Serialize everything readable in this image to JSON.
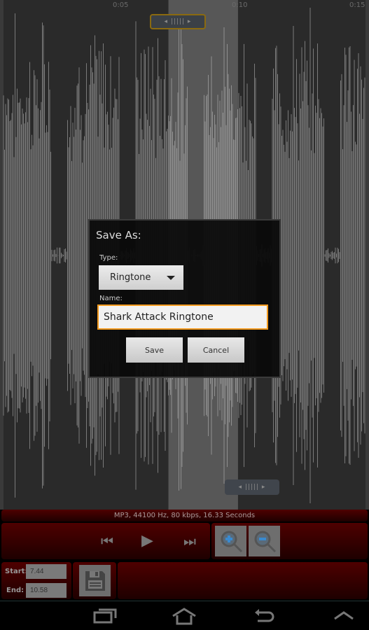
{
  "waveform": {
    "time_ticks": [
      "0:05",
      "0:10",
      "0:15"
    ],
    "selection_start_seconds": 7.44,
    "selection_end_seconds": 10.58,
    "duration_seconds": 16.33
  },
  "info": "MP3, 44100 Hz, 80 kbps, 16.33 Seconds",
  "controls": {
    "prev_icon": "skip-back-icon",
    "play_icon": "play-icon",
    "next_icon": "skip-forward-icon",
    "zoom_in_icon": "zoom-in-icon",
    "zoom_out_icon": "zoom-out-icon"
  },
  "times": {
    "start_label": "Start:",
    "start_value": "7.44",
    "end_label": "End:",
    "end_value": "10.58",
    "save_icon": "floppy-disk-icon"
  },
  "dialog": {
    "title": "Save As:",
    "type_label": "Type:",
    "type_value": "Ringtone",
    "name_label": "Name:",
    "name_value": "Shark Attack Ringtone",
    "save": "Save",
    "cancel": "Cancel"
  },
  "colors": {
    "accent": "#f39a1e",
    "panel": "#4e0000"
  }
}
